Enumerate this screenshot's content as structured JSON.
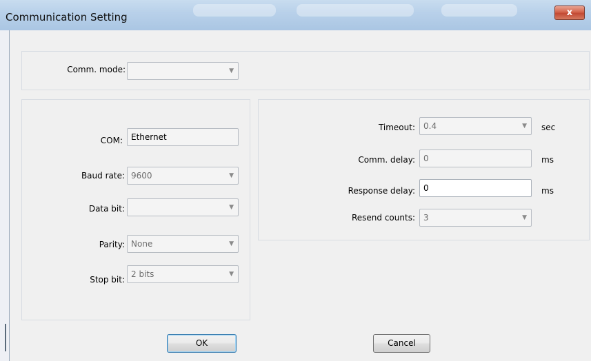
{
  "window": {
    "title": "Communication Setting",
    "close_glyph": "x"
  },
  "comm_mode": {
    "label": "Comm. mode:",
    "value": ""
  },
  "serial": {
    "com_label": "COM:",
    "com_value": "Ethernet",
    "baud_label": "Baud rate:",
    "baud_value": "9600",
    "databit_label": "Data bit:",
    "databit_value": "",
    "parity_label": "Parity:",
    "parity_value": "None",
    "stopbit_label": "Stop bit:",
    "stopbit_value": "2 bits"
  },
  "timing": {
    "timeout_label": "Timeout:",
    "timeout_value": "0.4",
    "timeout_unit": "sec",
    "commdelay_label": "Comm. delay:",
    "commdelay_value": "0",
    "commdelay_unit": "ms",
    "respdelay_label": "Response delay:",
    "respdelay_value": "0",
    "respdelay_unit": "ms",
    "resend_label": "Resend counts:",
    "resend_value": "3"
  },
  "buttons": {
    "ok": "OK",
    "cancel": "Cancel"
  },
  "icons": {
    "dropdown": "chevron-down-icon",
    "close": "close-icon"
  }
}
